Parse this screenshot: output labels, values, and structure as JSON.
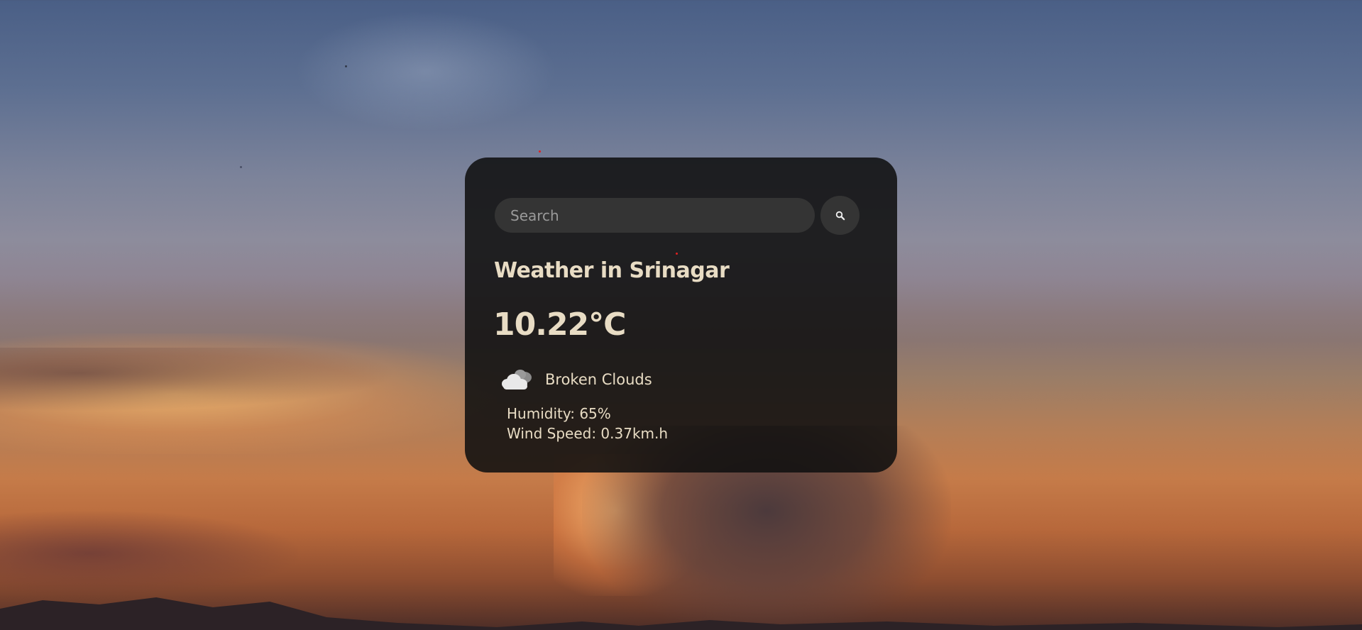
{
  "search": {
    "placeholder": "Search",
    "value": "",
    "button_icon": "search-icon"
  },
  "weather": {
    "title": "Weather in Srinagar",
    "temperature": "10.22°C",
    "condition_icon": "broken-clouds-icon",
    "condition": "Broken Clouds",
    "humidity": "Humidity: 65%",
    "wind_speed": "Wind Speed: 0.37km.h"
  },
  "colors": {
    "card_background": "#101010",
    "input_background": "#343434",
    "text": "#e8dcc4"
  }
}
